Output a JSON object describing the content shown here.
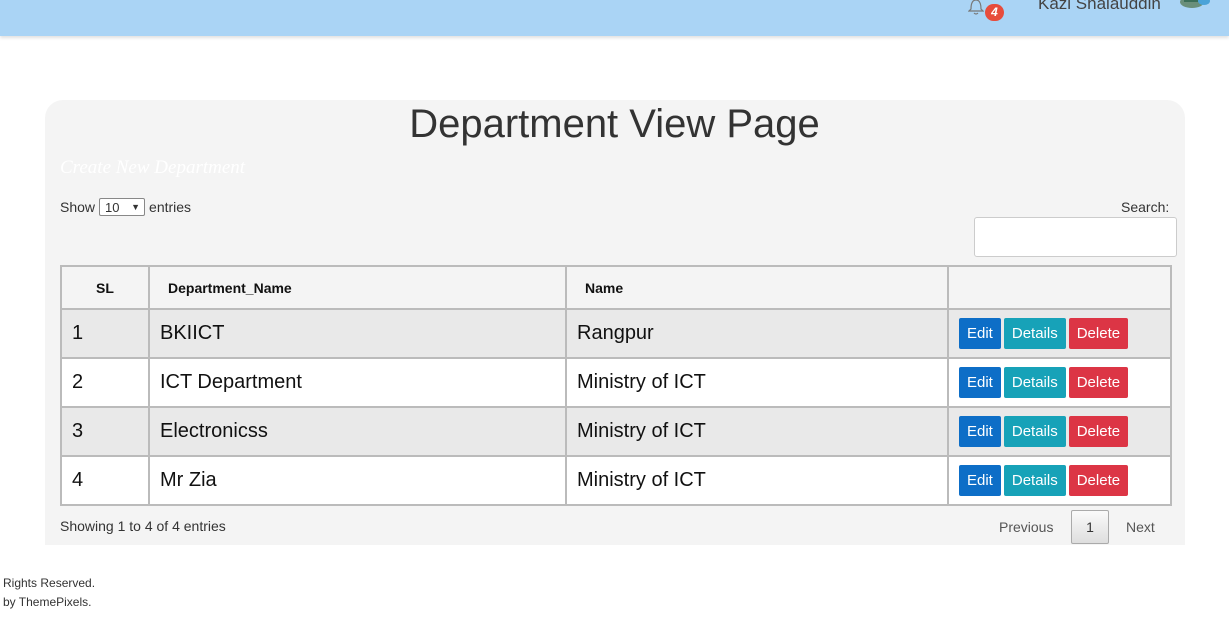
{
  "header": {
    "notification_count": "4",
    "user_name": "Kazi Shalauddin"
  },
  "page": {
    "title": "Department View Page",
    "create_link": "Create New Department"
  },
  "table_controls": {
    "show_label": "Show",
    "entries_value": "10",
    "entries_label": "entries",
    "search_label": "Search:"
  },
  "table": {
    "columns": [
      "SL",
      "Department_Name",
      "Name",
      ""
    ],
    "rows": [
      {
        "sl": "1",
        "department": "BKIICT",
        "name": "Rangpur"
      },
      {
        "sl": "2",
        "department": "ICT Department",
        "name": "Ministry of ICT"
      },
      {
        "sl": "3",
        "department": "Electronicss",
        "name": "Ministry of ICT"
      },
      {
        "sl": "4",
        "department": "Mr Zia",
        "name": "Ministry of ICT"
      }
    ],
    "actions": {
      "edit": "Edit",
      "details": "Details",
      "delete": "Delete"
    }
  },
  "pagination": {
    "info": "Showing 1 to 4 of 4 entries",
    "previous": "Previous",
    "current_page": "1",
    "next": "Next"
  },
  "footer": {
    "line1": "Rights Reserved.",
    "line2": "by ThemePixels."
  },
  "colors": {
    "topbar": "#aad4f5",
    "edit": "#0d6ec7",
    "details": "#17a2b8",
    "delete": "#dc3545",
    "badge": "#e74c3c"
  },
  "icons": {
    "bell": "bell-icon",
    "avatar": "user-avatar",
    "dropdown": "caret-down-icon"
  }
}
